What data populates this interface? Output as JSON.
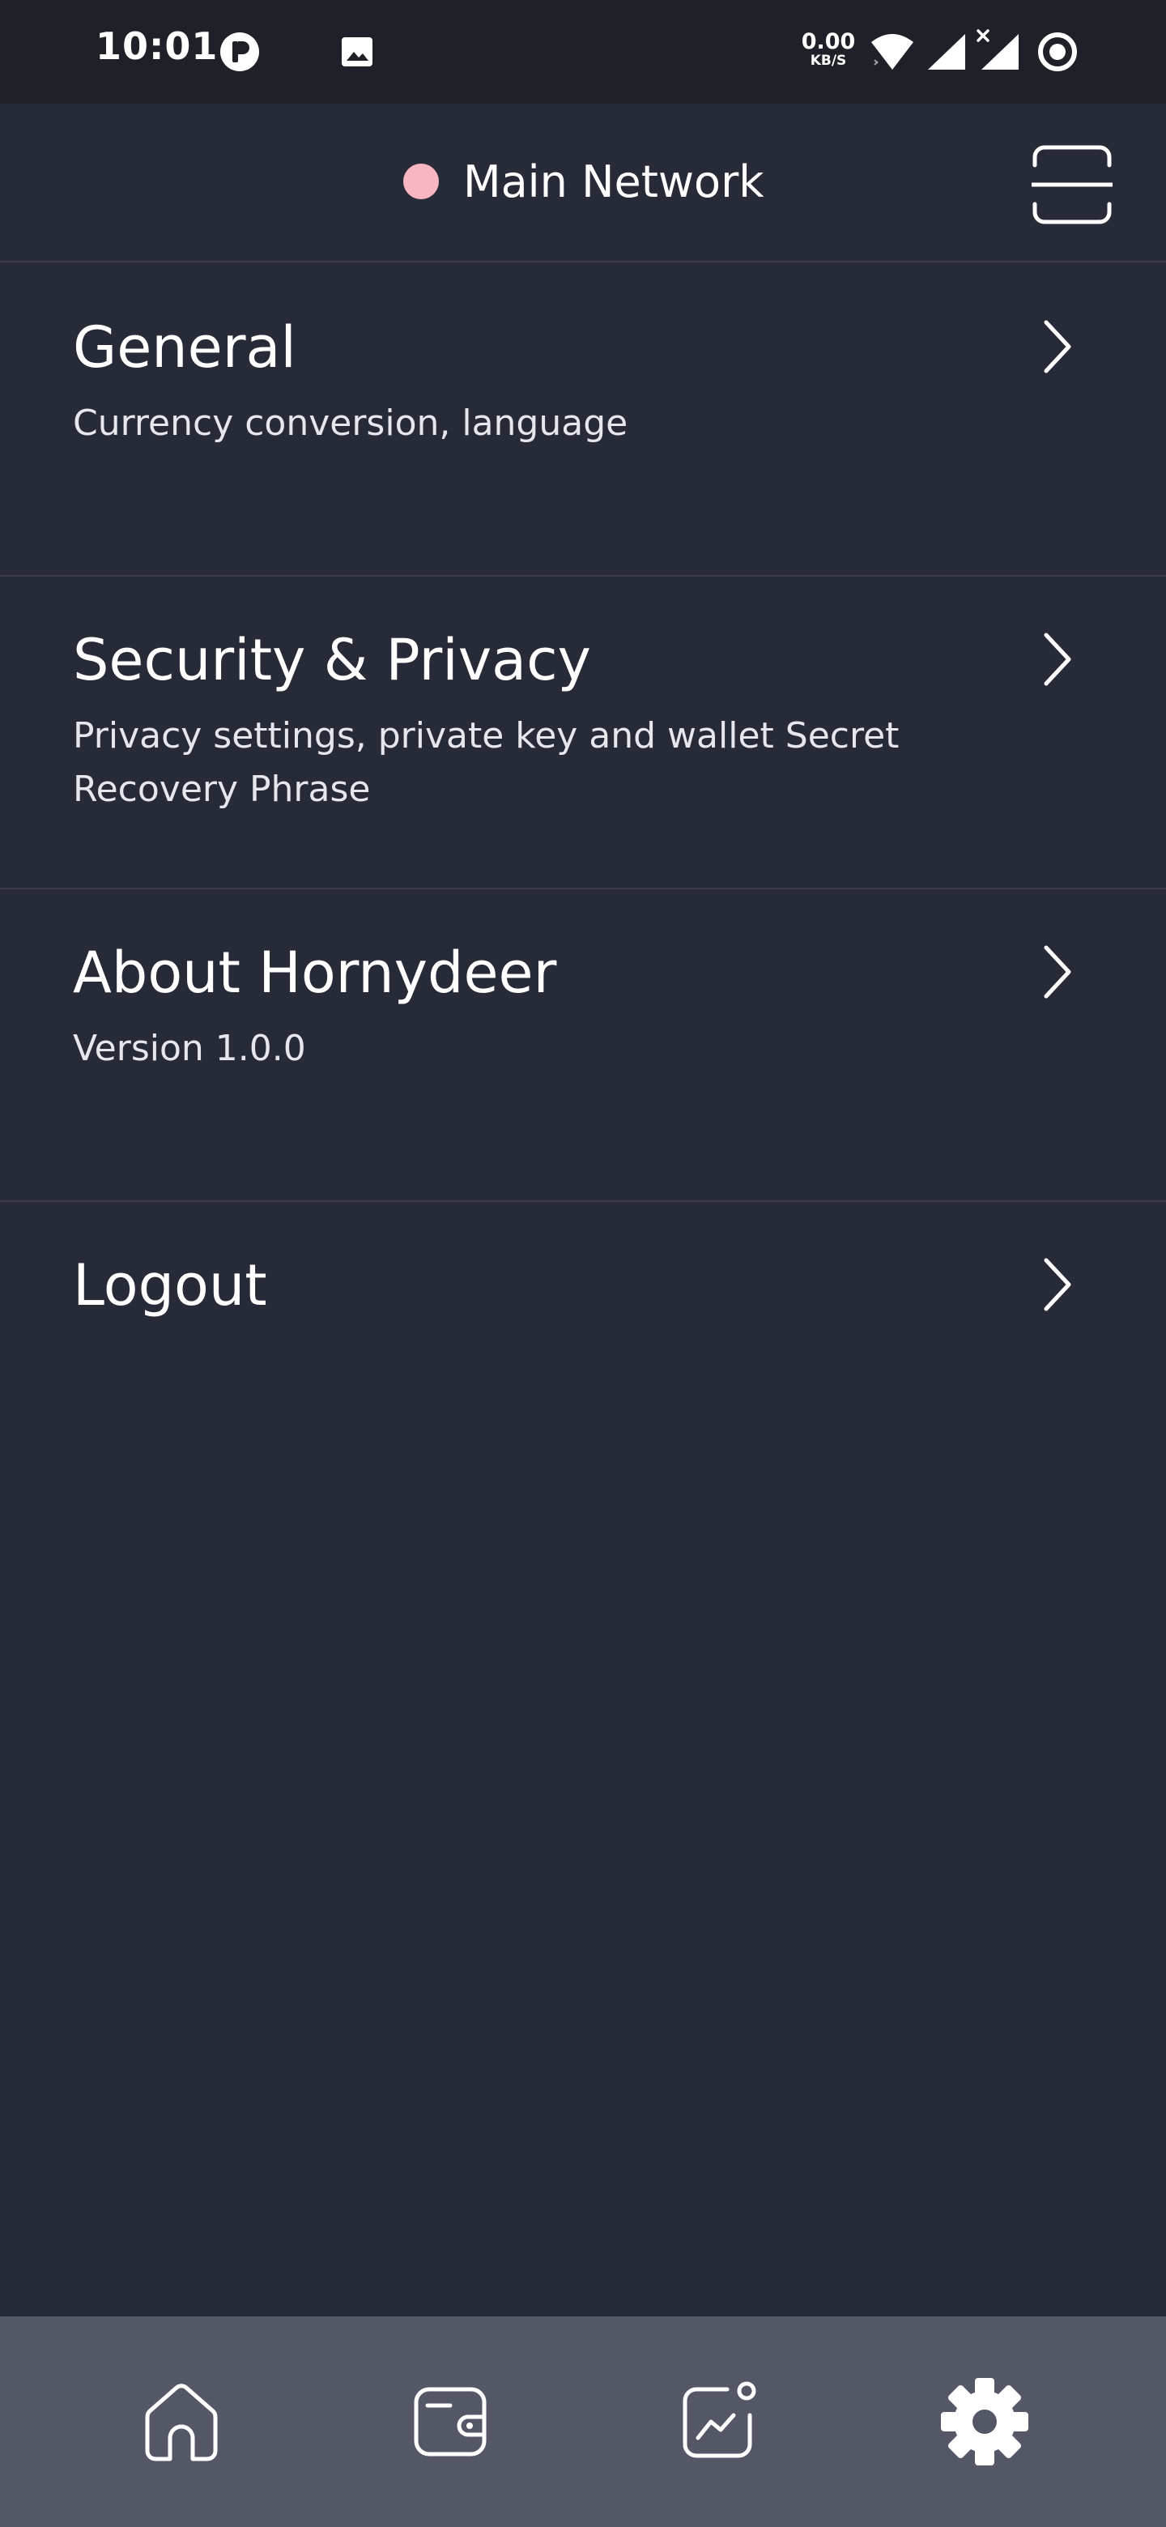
{
  "status_bar": {
    "time": "10:01",
    "net_speed_value": "0.00",
    "net_speed_unit": "KB/S",
    "icons": [
      "app-notification-icon",
      "image-icon",
      "wifi-icon",
      "signal-icon",
      "signal-no-data-icon",
      "ring-icon"
    ]
  },
  "header": {
    "network_label": "Main Network",
    "network_dot_color": "#f7b6c2",
    "scan_icon": "scan-frame-icon"
  },
  "menu": {
    "items": [
      {
        "title": "General",
        "subtitle": "Currency conversion, language"
      },
      {
        "title": "Security & Privacy",
        "subtitle": "Privacy settings, private key and wallet Secret Recovery Phrase"
      },
      {
        "title": "About Hornydeer",
        "subtitle": "Version 1.0.0"
      },
      {
        "title": "Logout",
        "subtitle": ""
      }
    ]
  },
  "bottom_nav": {
    "items": [
      {
        "icon": "home-icon",
        "active": false
      },
      {
        "icon": "wallet-icon",
        "active": false
      },
      {
        "icon": "chart-icon",
        "active": false
      },
      {
        "icon": "gear-icon",
        "active": true
      }
    ]
  },
  "colors": {
    "background": "#272a37",
    "status_bar": "#1f2129",
    "bottom_nav": "#545766",
    "divider": "#3a3d49",
    "text": "#ffffff"
  }
}
